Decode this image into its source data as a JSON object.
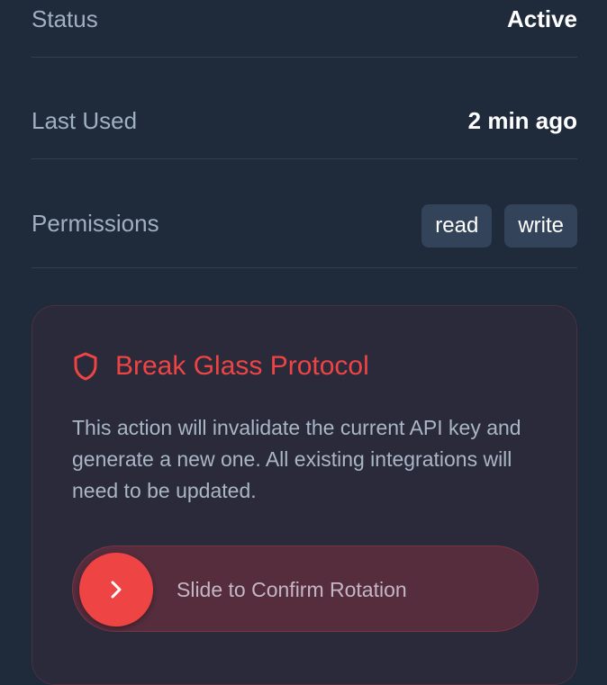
{
  "details": {
    "status_label": "Status",
    "status_value": "Active",
    "last_used_label": "Last Used",
    "last_used_value": "2 min ago",
    "permissions_label": "Permissions",
    "permissions": [
      "read",
      "write"
    ]
  },
  "danger": {
    "icon": "shield-icon",
    "title": "Break Glass Protocol",
    "description": "This action will invalidate the current API key and generate a new one. All existing integrations will need to be updated.",
    "slider_label": "Slide to Confirm Rotation",
    "slider_icon": "chevron-right-icon",
    "accent_color": "#ef4444"
  }
}
